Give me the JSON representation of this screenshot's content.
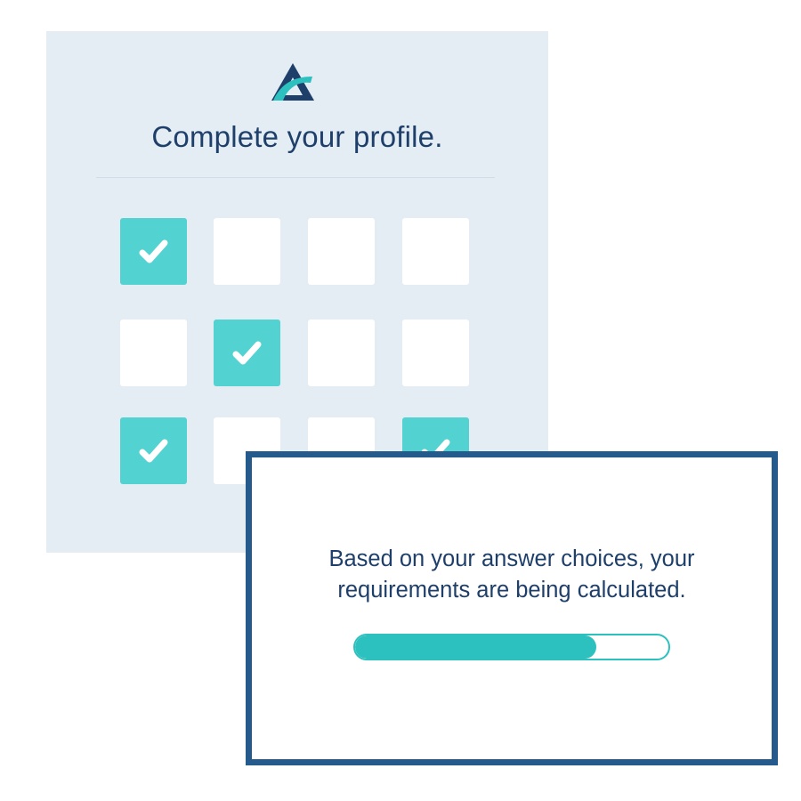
{
  "profile": {
    "title": "Complete your profile.",
    "logo_icon": "triangle-a-logo-icon",
    "checkboxes": [
      [
        true,
        false,
        false,
        false
      ],
      [
        false,
        true,
        false,
        false
      ],
      [
        true,
        false,
        false,
        true
      ]
    ]
  },
  "dialog": {
    "line1": "Based on your answer choices, your",
    "line2": "requirements are being calculated.",
    "progress": 0.77
  },
  "colors": {
    "card_background": "#e4ecf4",
    "title_text": "#1f3f6b",
    "checked": "#52d2d0",
    "dialog_border": "#255a8c",
    "progress": "#2cc0be",
    "logo_dark": "#1f3f6b",
    "logo_teal": "#2cc0be"
  }
}
